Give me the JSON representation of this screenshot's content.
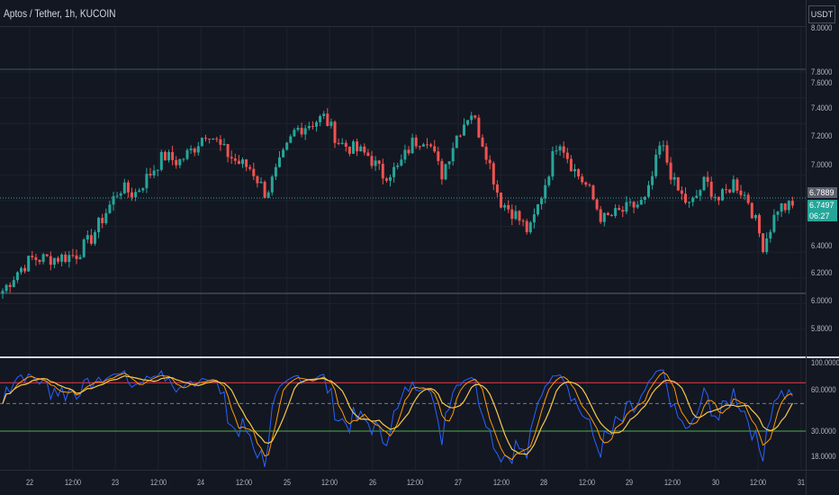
{
  "header": {
    "title": "Aptos / Tether, 1h, KUCOIN",
    "currency": "USDT"
  },
  "price_axis": {
    "ticks": [
      "8.0000",
      "7.8000",
      "7.6000",
      "7.4000",
      "7.2000",
      "7.0000",
      "6.4000",
      "6.2000",
      "6.0000",
      "5.8000"
    ],
    "last_price": "6.7889",
    "current_price": "6.7497",
    "countdown": "06:27"
  },
  "rsi_axis": {
    "ticks": [
      "100.0000",
      "60.0000",
      "30.0000",
      "18.0000"
    ]
  },
  "time_axis": {
    "ticks": [
      "22",
      "12:00",
      "23",
      "12:00",
      "24",
      "12:00",
      "25",
      "12:00",
      "26",
      "12:00",
      "27",
      "12:00",
      "28",
      "12:00",
      "29",
      "12:00",
      "30",
      "12:00",
      "31"
    ]
  },
  "colors": {
    "up": "#26a69a",
    "down": "#ef5350",
    "rsi": "#2962ff",
    "ma": "#f7c948",
    "upper": "#f23645",
    "lower": "#4caf50"
  },
  "chart_data": {
    "type": "candlestick",
    "symbol": "APT/USDT",
    "interval": "1h",
    "price_path": [
      6.1,
      6.25,
      6.35,
      6.35,
      6.36,
      6.38,
      6.5,
      6.7,
      6.9,
      6.85,
      7.0,
      7.15,
      7.1,
      7.2,
      7.35,
      7.2,
      7.1,
      7.05,
      6.85,
      7.1,
      7.35,
      7.4,
      7.45,
      7.25,
      7.2,
      7.15,
      7.0,
      7.05,
      7.25,
      7.3,
      7.0,
      7.3,
      7.5,
      7.2,
      6.8,
      6.7,
      6.55,
      6.9,
      7.3,
      7.05,
      6.9,
      6.65,
      6.7,
      6.75,
      6.8,
      7.25,
      6.9,
      6.75,
      6.95,
      6.8,
      6.95,
      6.8,
      6.45,
      6.75,
      6.75
    ],
    "rsi_levels": [
      70,
      30
    ]
  }
}
